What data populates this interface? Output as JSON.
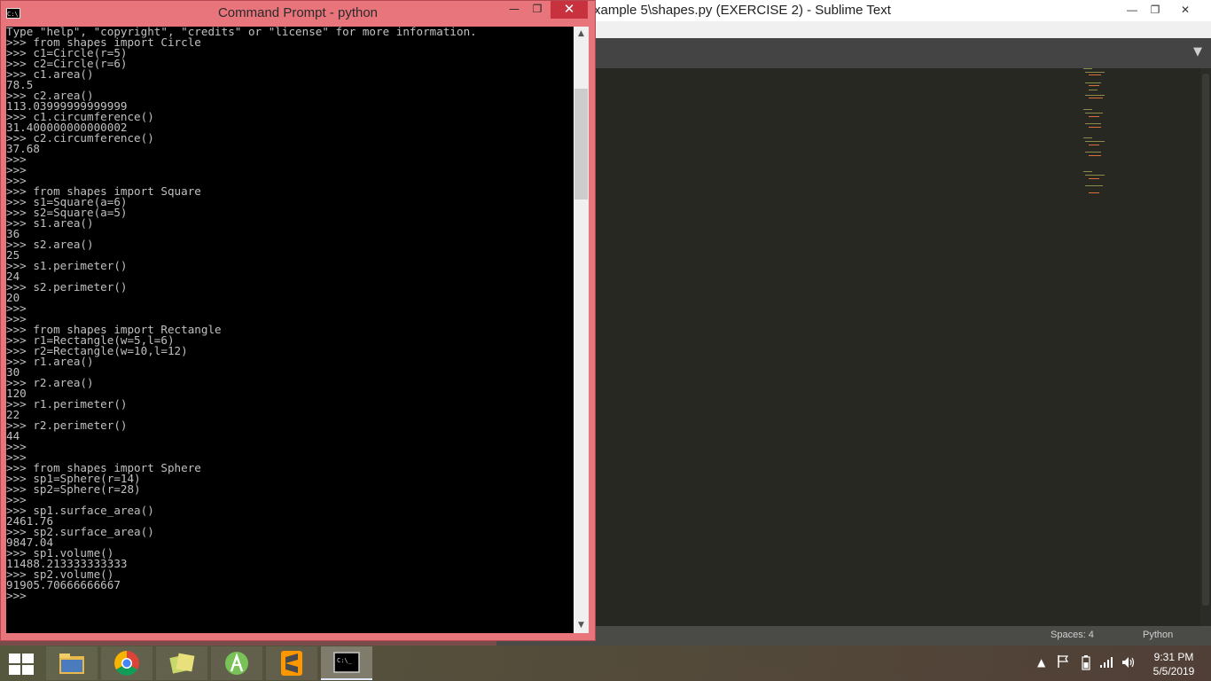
{
  "sublime": {
    "title": "xample 5\\shapes.py (EXERCISE 2) - Sublime Text",
    "minimize": "—",
    "maximize": "❐",
    "close": "✕",
    "tab_dropdown": "▼",
    "status_spaces": "Spaces: 4",
    "status_syntax": "Python"
  },
  "cmd": {
    "icon_text": "C:\\.",
    "title": "Command Prompt - python",
    "minimize": "—",
    "maximize": "❐",
    "close": "✕",
    "scroll_up": "▲",
    "scroll_down": "▼",
    "console_text": "Type \"help\", \"copyright\", \"credits\" or \"license\" for more information.\n>>> from shapes import Circle\n>>> c1=Circle(r=5)\n>>> c2=Circle(r=6)\n>>> c1.area()\n78.5\n>>> c2.area()\n113.03999999999999\n>>> c1.circumference()\n31.400000000000002\n>>> c2.circumference()\n37.68\n>>>\n>>>\n>>>\n>>> from shapes import Square\n>>> s1=Square(a=6)\n>>> s2=Square(a=5)\n>>> s1.area()\n36\n>>> s2.area()\n25\n>>> s1.perimeter()\n24\n>>> s2.perimeter()\n20\n>>>\n>>>\n>>> from shapes import Rectangle\n>>> r1=Rectangle(w=5,l=6)\n>>> r2=Rectangle(w=10,l=12)\n>>> r1.area()\n30\n>>> r2.area()\n120\n>>> r1.perimeter()\n22\n>>> r2.perimeter()\n44\n>>>\n>>>\n>>> from shapes import Sphere\n>>> sp1=Sphere(r=14)\n>>> sp2=Sphere(r=28)\n>>>\n>>> sp1.surface_area()\n2461.76\n>>> sp2.surface_area()\n9847.04\n>>> sp1.volume()\n11488.213333333333\n>>> sp2.volume()\n91905.70666666667\n>>>"
  },
  "taskbar": {
    "apps": [
      {
        "name": "file-explorer-icon",
        "label": "File Explorer"
      },
      {
        "name": "chrome-icon",
        "label": "Google Chrome"
      },
      {
        "name": "photos-icon",
        "label": "Photos"
      },
      {
        "name": "android-studio-icon",
        "label": "Android Studio"
      },
      {
        "name": "sublime-text-icon",
        "label": "Sublime Text"
      },
      {
        "name": "command-prompt-icon",
        "label": "Command Prompt"
      }
    ],
    "cmd_icon_text": "C:\\_",
    "tray_up_arrow": "▲",
    "time": "9:31 PM",
    "date": "5/5/2019"
  }
}
